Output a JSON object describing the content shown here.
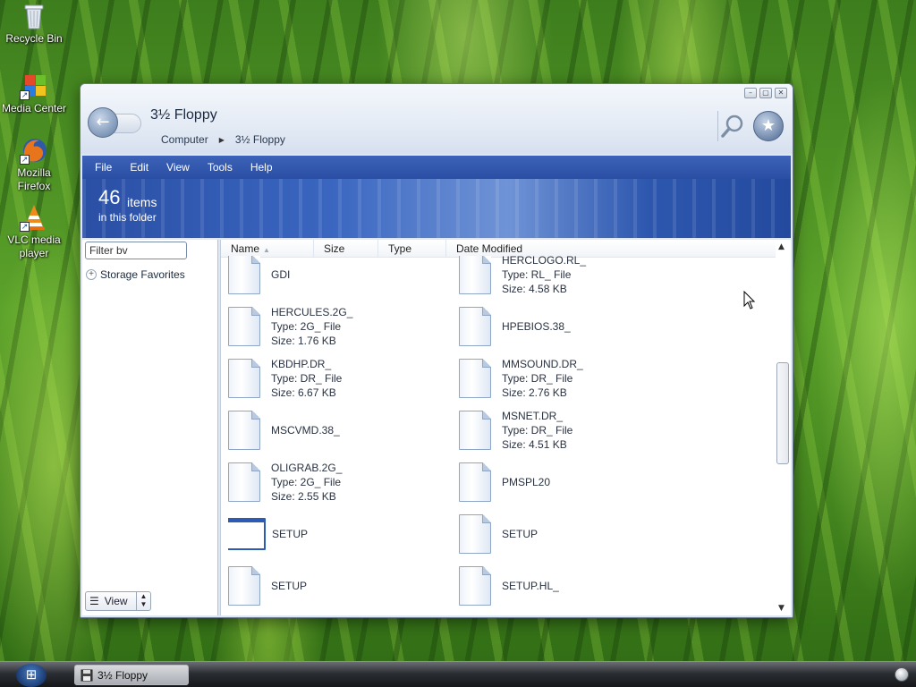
{
  "desktop": {
    "icons": [
      {
        "label": "Recycle Bin",
        "icon": "recycle-bin-icon"
      },
      {
        "label": "Media Center",
        "icon": "media-center-icon"
      },
      {
        "label": "Mozilla Firefox",
        "icon": "firefox-icon"
      },
      {
        "label": "VLC media player",
        "icon": "vlc-icon"
      }
    ]
  },
  "window": {
    "title": "3½ Floppy",
    "breadcrumb": [
      "Computer",
      "3½ Floppy"
    ],
    "menu": [
      "File",
      "Edit",
      "View",
      "Tools",
      "Help"
    ],
    "item_count": "46",
    "item_unit": "items",
    "item_sub": "in this folder",
    "filter_placeholder": "Filter by",
    "filter_value": "Filter bv",
    "storage_favorites": "Storage Favorites",
    "view_button": "View",
    "columns": [
      "Name",
      "Size",
      "Type",
      "Date Modified"
    ]
  },
  "files": {
    "r0c0": {
      "name": "GDI"
    },
    "r0c1": {
      "name": "HERCLOGO.RL_",
      "type": "Type: RL_ File",
      "size": "Size: 4.58 KB"
    },
    "r1c0": {
      "name": "HERCULES.2G_",
      "type": "Type: 2G_ File",
      "size": "Size: 1.76 KB"
    },
    "r1c1": {
      "name": "HPEBIOS.38_"
    },
    "r2c0": {
      "name": "KBDHP.DR_",
      "type": "Type: DR_ File",
      "size": "Size: 6.67 KB"
    },
    "r2c1": {
      "name": "MMSOUND.DR_",
      "type": "Type: DR_ File",
      "size": "Size: 2.76 KB"
    },
    "r3c0": {
      "name": "MSCVMD.38_"
    },
    "r3c1": {
      "name": "MSNET.DR_",
      "type": "Type: DR_ File",
      "size": "Size: 4.51 KB"
    },
    "r4c0": {
      "name": "OLIGRAB.2G_",
      "type": "Type: 2G_ File",
      "size": "Size: 2.55 KB"
    },
    "r4c1": {
      "name": "PMSPL20"
    },
    "r5c0": {
      "name": "SETUP"
    },
    "r5c1": {
      "name": "SETUP"
    },
    "r6c0": {
      "name": "SETUP"
    },
    "r6c1": {
      "name": "SETUP.HL_"
    }
  },
  "taskbar": {
    "task_label": "3½ Floppy"
  },
  "colors": {
    "menubar": "#2a4ea4",
    "accent": "#3a66c0"
  }
}
